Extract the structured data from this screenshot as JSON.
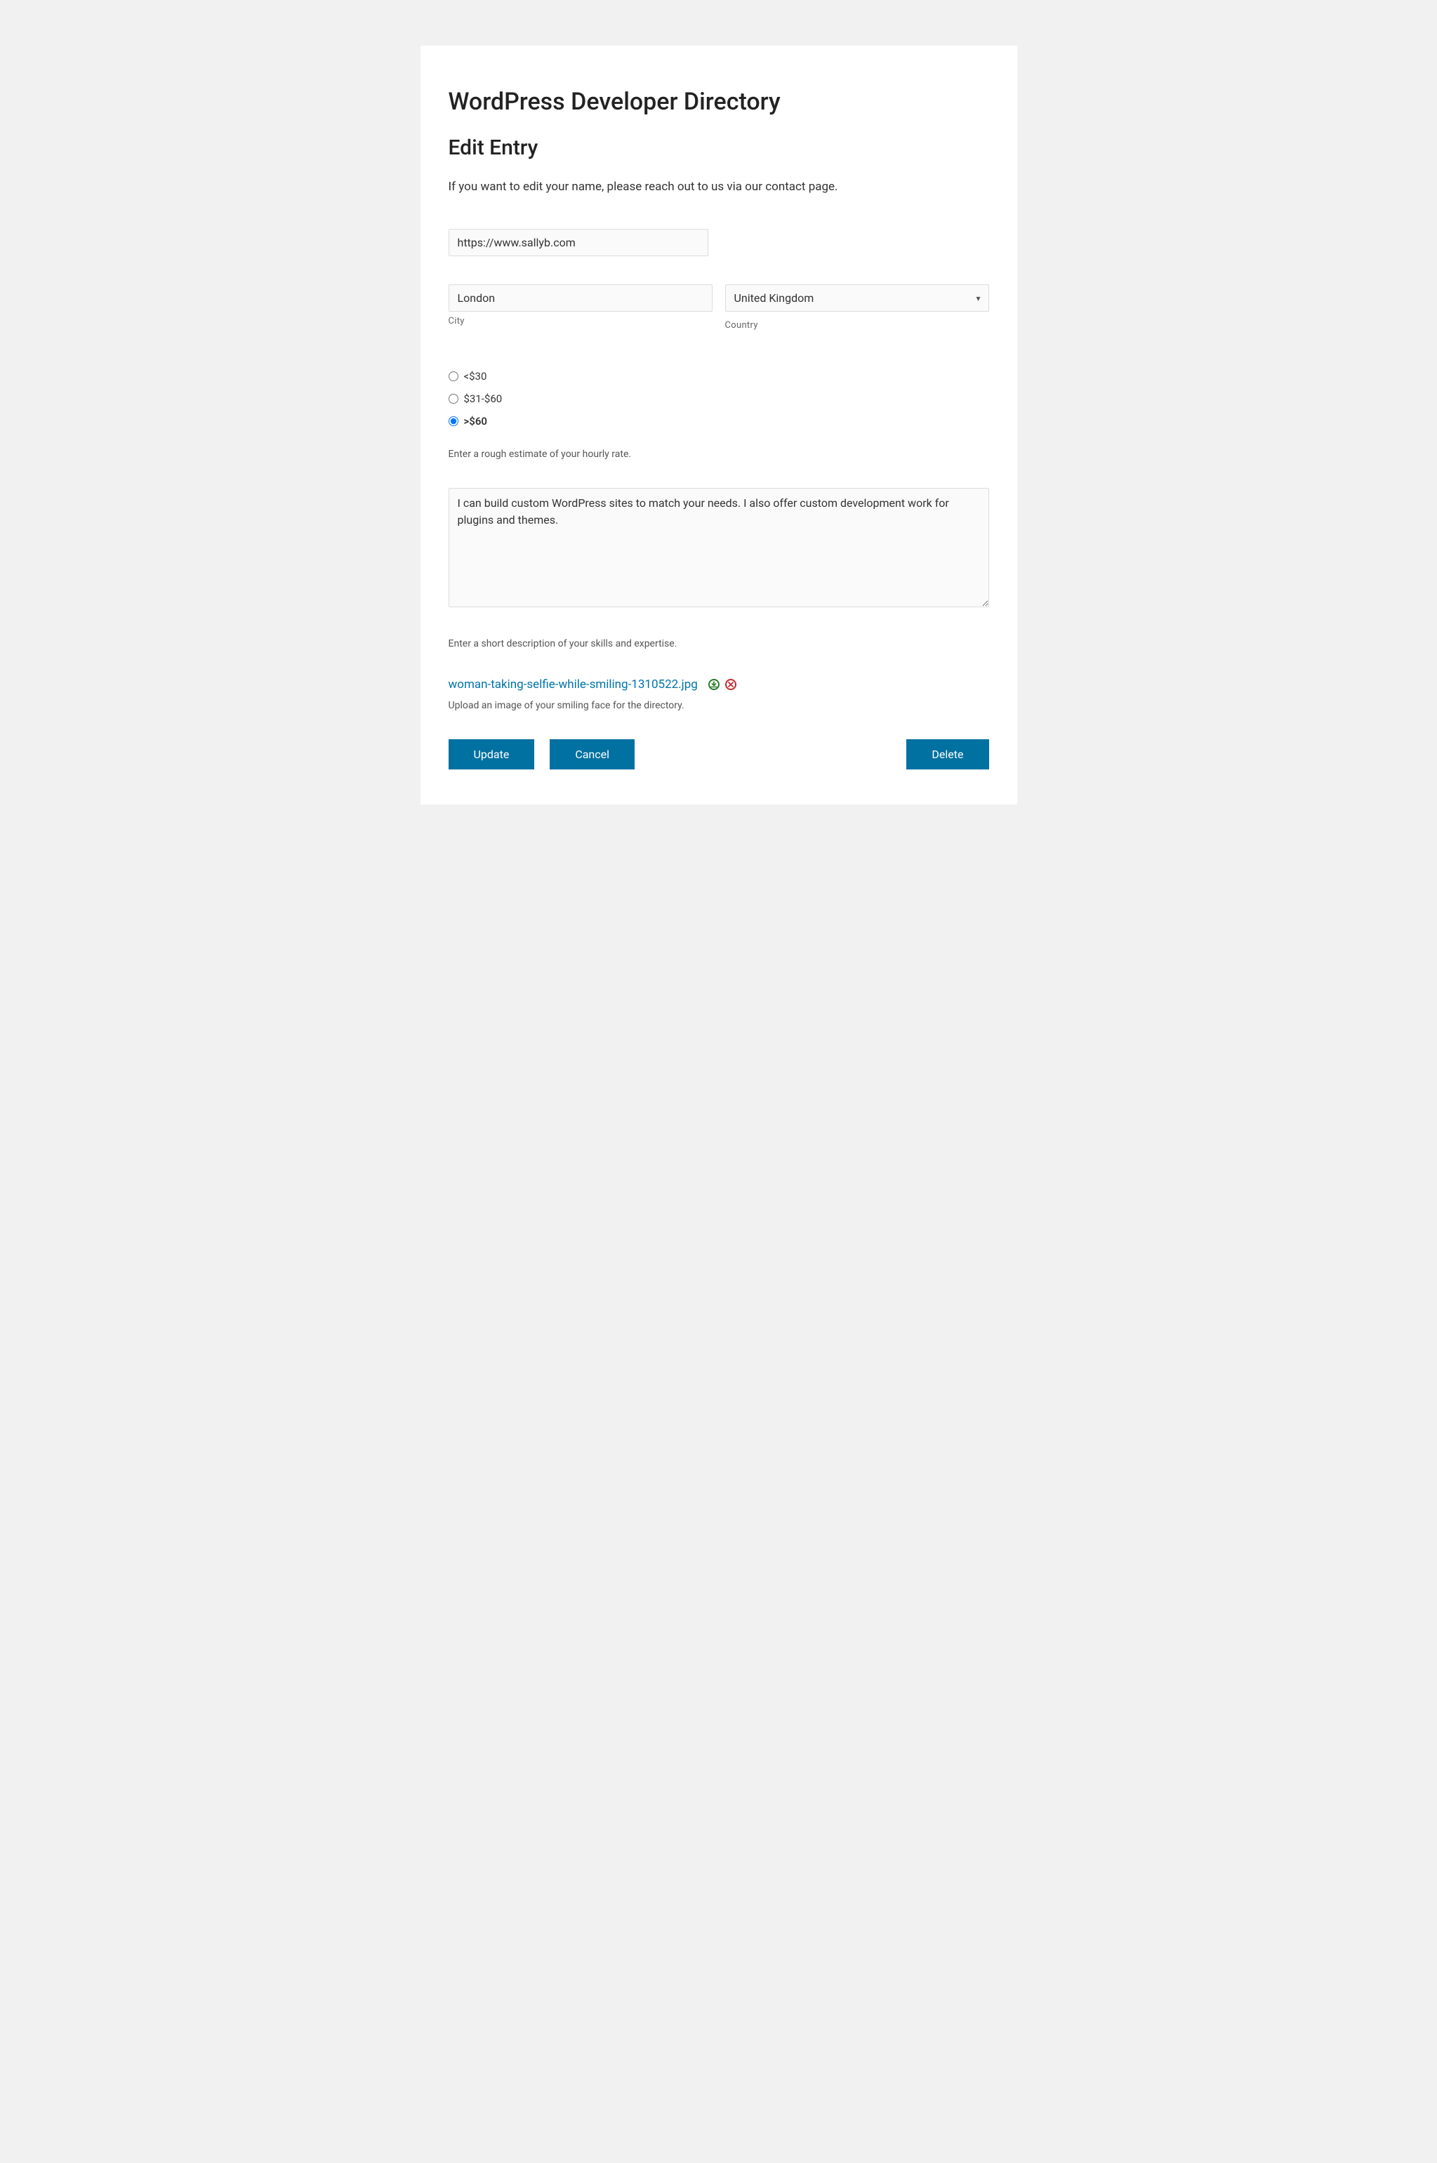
{
  "page": {
    "title": "WordPress Developer Directory",
    "subtitle": "Edit Entry",
    "intro": "If you want to edit your name, please reach out to us via our contact page."
  },
  "form": {
    "website": {
      "value": "https://www.sallyb.com"
    },
    "city": {
      "value": "London",
      "label": "City"
    },
    "country": {
      "value": "United Kingdom",
      "label": "Country"
    },
    "rate": {
      "options": [
        {
          "label": "<$30",
          "selected": false
        },
        {
          "label": "$31-$60",
          "selected": false
        },
        {
          "label": ">$60",
          "selected": true
        }
      ],
      "help": "Enter a rough estimate of your hourly rate."
    },
    "description": {
      "value": "I can build custom WordPress sites to match your needs. I also offer custom development work for plugins and themes.",
      "help": "Enter a short description of your skills and expertise."
    },
    "image": {
      "filename": "woman-taking-selfie-while-smiling-1310522.jpg",
      "help": "Upload an image of your smiling face for the directory."
    }
  },
  "buttons": {
    "update": "Update",
    "cancel": "Cancel",
    "delete": "Delete"
  }
}
